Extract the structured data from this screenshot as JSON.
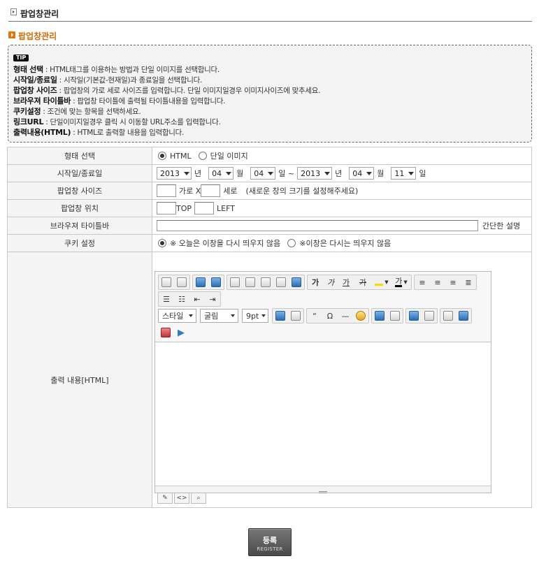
{
  "page_header": {
    "title": "팝업창관리"
  },
  "section": {
    "title": "팝업창관리"
  },
  "tip": {
    "badge": "TIP",
    "lines": [
      {
        "term": "형태 선택",
        "desc": " : HTML태그를 이용하는 방법과 단일 이미지를 선택합니다."
      },
      {
        "term": "시작일/종료일",
        "desc": " : 시작일(기본값-현재일)과 종료일을 선택합니다."
      },
      {
        "term": "팝업창 사이즈",
        "desc": " : 팝업창의 가로 세로 사이즈를 입력합니다. 단일 이미지일경우 이미지사이즈에 맞추세요."
      },
      {
        "term": "브라우져 타이틀바",
        "desc": " : 팝업창 타이틀에 출력될 타이틀내용을 입력합니다."
      },
      {
        "term": "쿠키설정",
        "desc": " : 조건에 맞는 항목을 선택하세요."
      },
      {
        "term": "링크URL",
        "desc": " : 단일이미지일경우 클릭 시 이동할 URL주소를 입력합니다."
      },
      {
        "term": "출력내용(HTML)",
        "desc": " : HTML로 출력할 내용을 입력합니다."
      }
    ]
  },
  "form": {
    "type_label": "형태 선택",
    "type_opt_html": "HTML",
    "type_opt_image": "단일 이미지",
    "date_label": "시작일/종료일",
    "start_year": "2013",
    "start_month": "04",
    "start_day": "04",
    "end_year": "2013",
    "end_month": "04",
    "end_day": "11",
    "unit_year": "년",
    "unit_month": "월",
    "unit_day": "일",
    "unit_day_tilde": "일 ~",
    "size_label": "팝업창 사이즈",
    "size_width_text": "가로 X",
    "size_height_text": "세로",
    "size_note": "(새로운 창의 크기를 설정해주세요)",
    "pos_label": "팝업창 위치",
    "pos_top_text": "TOP",
    "pos_left_text": "LEFT",
    "title_label": "브라우져 타이틀바",
    "title_note": "간단한 설명",
    "cookie_label": "쿠키 설정",
    "cookie_opt1": "※ 오늘은 이창을 다시 띄우지 않음",
    "cookie_opt2": "※이창은 다시는 띄우지 않음",
    "content_label": "출력 내용[HTML]"
  },
  "editor": {
    "style_select": "스타일",
    "font_select": "굴림",
    "size_select": "9pt",
    "btn_font_a": "가",
    "btn_font_b": "가",
    "btn_font_c": "가",
    "btn_strike": "가",
    "btn_color": "가",
    "btn_quote": "“",
    "btn_omega": "Ω"
  },
  "register": {
    "label_ko": "등록",
    "label_en": "REGISTER"
  }
}
